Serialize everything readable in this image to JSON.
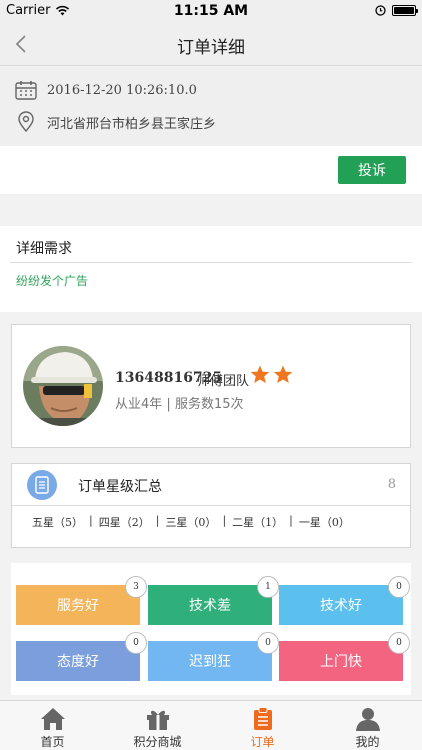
{
  "status_bar": {
    "carrier": "Carrier",
    "time": "11:15 AM"
  },
  "nav": {
    "title": "订单详细"
  },
  "order": {
    "datetime": "2016-12-20 10:26:10.0",
    "address": "河北省邢台市柏乡县王家庄乡"
  },
  "complaint": {
    "label": "投诉"
  },
  "detail": {
    "title": "详细需求",
    "text": "纷纷发个广告"
  },
  "master": {
    "phone": "13648816725",
    "team": "师傅团队",
    "stars": 2,
    "experience": "从业4年",
    "separator": "|",
    "service": "服务数15次"
  },
  "rating": {
    "title": "订单星级汇总",
    "count": "8",
    "items": [
      "五星（5）",
      "四星（2）",
      "三星（0）",
      "二星（1）",
      "一星（0）"
    ],
    "separator": "|"
  },
  "tags": [
    {
      "label": "服务好",
      "count": "3",
      "color": "#f4b55a"
    },
    {
      "label": "技术差",
      "count": "1",
      "color": "#2fb07b"
    },
    {
      "label": "技术好",
      "count": "0",
      "color": "#5cc0ee"
    },
    {
      "label": "态度好",
      "count": "0",
      "color": "#7b9fdc"
    },
    {
      "label": "迟到狂",
      "count": "0",
      "color": "#72b7f2"
    },
    {
      "label": "上门快",
      "count": "0",
      "color": "#f2647f"
    }
  ],
  "tabbar": {
    "items": [
      {
        "label": "首页",
        "icon": "home-icon"
      },
      {
        "label": "积分商城",
        "icon": "gift-icon"
      },
      {
        "label": "订单",
        "icon": "clipboard-icon"
      },
      {
        "label": "我的",
        "icon": "person-icon"
      }
    ],
    "active_color": "#ef6a1d"
  }
}
